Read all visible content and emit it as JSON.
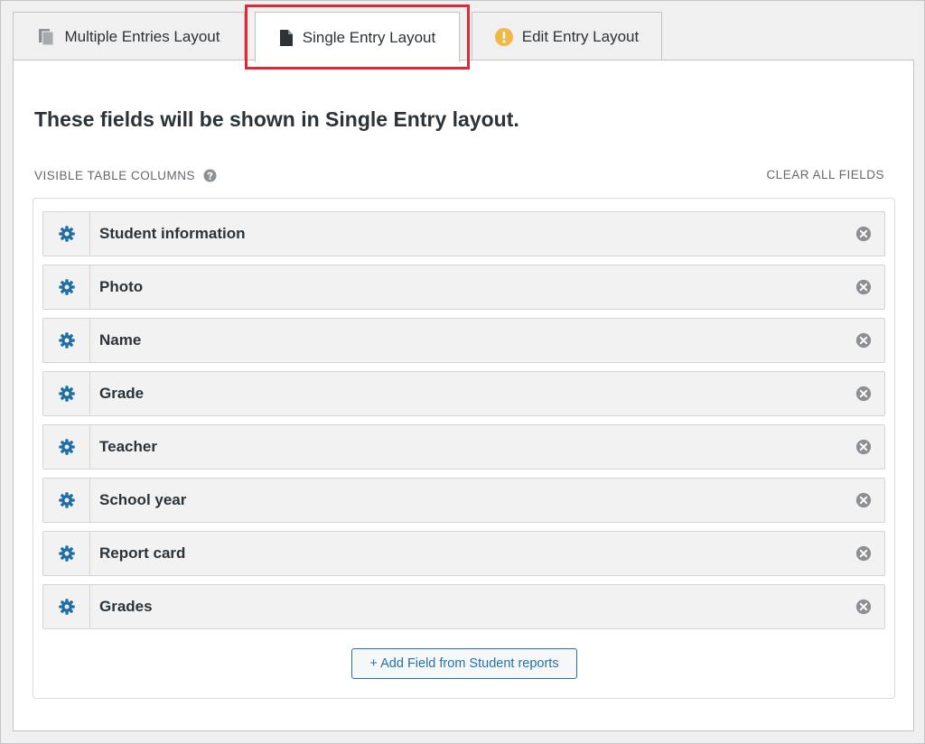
{
  "tabs": [
    {
      "label": "Multiple Entries Layout",
      "icon": "copy-icon"
    },
    {
      "label": "Single Entry Layout",
      "icon": "document-icon"
    },
    {
      "label": "Edit Entry Layout",
      "icon": "warning-icon"
    }
  ],
  "panel": {
    "heading": "These fields will be shown in Single Entry layout.",
    "section_label": "VISIBLE TABLE COLUMNS",
    "clear_label": "CLEAR ALL FIELDS",
    "fields": [
      "Student information",
      "Photo",
      "Name",
      "Grade",
      "Teacher",
      "School year",
      "Report card",
      "Grades"
    ],
    "add_button": "+ Add Field from Student reports"
  },
  "colors": {
    "accent": "#2271b1",
    "gear": "#1e6fa8",
    "highlight": "#e32636",
    "warning": "#f0b849"
  }
}
